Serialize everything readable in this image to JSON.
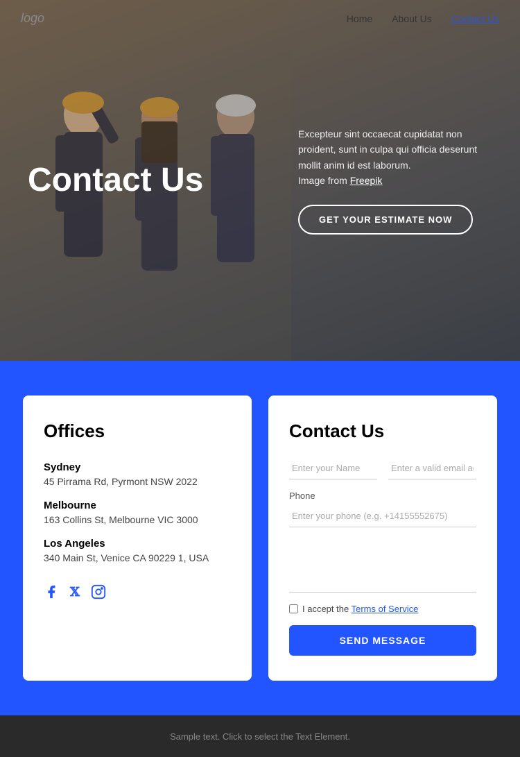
{
  "nav": {
    "logo": "logo",
    "links": [
      {
        "label": "Home",
        "active": false
      },
      {
        "label": "About Us",
        "active": false
      },
      {
        "label": "Contact Us",
        "active": true
      }
    ]
  },
  "hero": {
    "title": "Contact Us",
    "description": "Excepteur sint occaecat cupidatat non proident, sunt in culpa qui officia deserunt mollit anim id est laborum.",
    "image_credit_prefix": "Image from ",
    "image_credit_link": "Freepik",
    "cta_button": "GET YOUR ESTIMATE NOW"
  },
  "offices": {
    "section_title": "Offices",
    "locations": [
      {
        "city": "Sydney",
        "address": "45 Pirrama Rd, Pyrmont NSW 2022"
      },
      {
        "city": "Melbourne",
        "address": "163 Collins St, Melbourne VIC 3000"
      },
      {
        "city": "Los Angeles",
        "address": "340 Main St, Venice CA 90229 1, USA"
      }
    ],
    "social": [
      {
        "name": "facebook",
        "icon": "f"
      },
      {
        "name": "twitter-x",
        "icon": "𝕏"
      },
      {
        "name": "instagram",
        "icon": "◎"
      }
    ]
  },
  "contact_form": {
    "title": "Contact Us",
    "name_placeholder": "Enter your Name",
    "email_placeholder": "Enter a valid email address",
    "phone_label": "Phone",
    "phone_placeholder": "Enter your phone (e.g. +14155552675)",
    "message_placeholder": "",
    "terms_prefix": "I accept the ",
    "terms_link": "Terms of Service",
    "submit_button": "SEND MESSAGE"
  },
  "footer": {
    "text": "Sample text. Click to select the Text Element."
  }
}
